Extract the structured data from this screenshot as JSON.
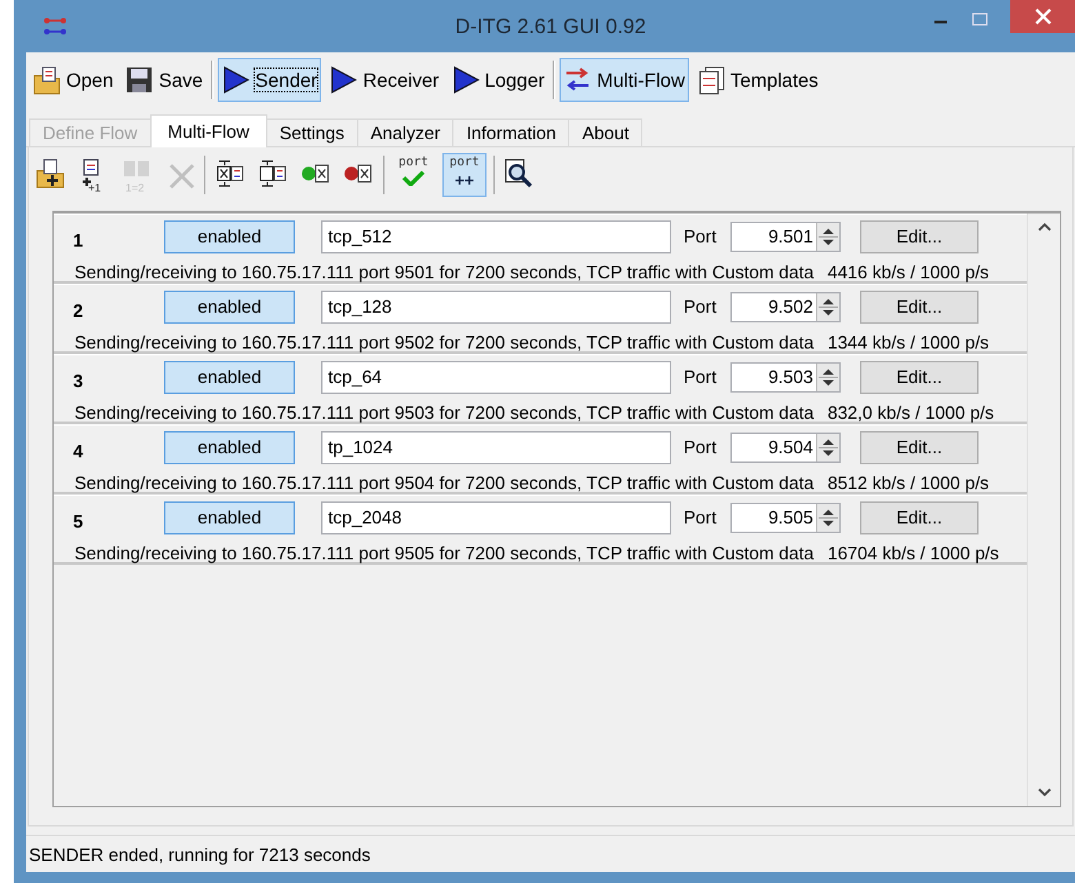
{
  "window": {
    "title": "D-ITG 2.61 GUI 0.92"
  },
  "toolbar": [
    {
      "kind": "open",
      "label": "Open",
      "selected": false
    },
    {
      "kind": "save",
      "label": "Save",
      "selected": false
    },
    {
      "kind": "play",
      "label": "Sender",
      "selected": true
    },
    {
      "kind": "play",
      "label": "Receiver",
      "selected": false
    },
    {
      "kind": "play",
      "label": "Logger",
      "selected": false
    },
    {
      "kind": "multiflow",
      "label": "Multi-Flow",
      "selected": true
    },
    {
      "kind": "templates",
      "label": "Templates",
      "selected": false
    }
  ],
  "tabs": [
    {
      "label": "Define Flow",
      "selected": false,
      "disabled": true
    },
    {
      "label": "Multi-Flow",
      "selected": true,
      "disabled": false
    },
    {
      "label": "Settings",
      "selected": false,
      "disabled": false
    },
    {
      "label": "Analyzer",
      "selected": false,
      "disabled": false
    },
    {
      "label": "Information",
      "selected": false,
      "disabled": false
    },
    {
      "label": "About",
      "selected": false,
      "disabled": false
    }
  ],
  "tools": [
    {
      "kind": "add-folder",
      "disabled": false,
      "selected": false
    },
    {
      "kind": "add-one",
      "text": "+1",
      "disabled": false,
      "selected": false
    },
    {
      "kind": "duplicate",
      "text": "1=2",
      "disabled": true,
      "selected": false
    },
    {
      "kind": "delete",
      "disabled": true,
      "selected": false
    },
    {
      "kind": "sep"
    },
    {
      "kind": "move-up",
      "disabled": false,
      "selected": false
    },
    {
      "kind": "move-down",
      "disabled": false,
      "selected": false
    },
    {
      "kind": "enable",
      "disabled": false,
      "selected": false
    },
    {
      "kind": "disable",
      "disabled": false,
      "selected": false
    },
    {
      "kind": "sep"
    },
    {
      "kind": "port-check",
      "text": "port",
      "disabled": false
    },
    {
      "kind": "port-add",
      "text": "port",
      "sub": "++",
      "disabled": false,
      "pressed": true
    },
    {
      "kind": "sep"
    },
    {
      "kind": "inspect",
      "disabled": false,
      "selected": false
    }
  ],
  "flows": [
    {
      "number": "1",
      "state": "enabled",
      "enabled": true,
      "name": "tcp_512",
      "port_label": "Port",
      "port": "9.501",
      "edit": "Edit...",
      "description": "Sending/receiving to 160.75.17.111 port 9501 for 7200 seconds, TCP traffic with Custom data",
      "rate": "4416 kb/s / 1000 p/s"
    },
    {
      "number": "2",
      "state": "enabled",
      "enabled": true,
      "name": "tcp_128",
      "port_label": "Port",
      "port": "9.502",
      "edit": "Edit...",
      "description": "Sending/receiving to 160.75.17.111 port 9502 for 7200 seconds, TCP traffic with Custom data",
      "rate": "1344 kb/s / 1000 p/s"
    },
    {
      "number": "3",
      "state": "enabled",
      "enabled": true,
      "name": "tcp_64",
      "port_label": "Port",
      "port": "9.503",
      "edit": "Edit...",
      "description": "Sending/receiving to 160.75.17.111 port 9503 for 7200 seconds, TCP traffic with Custom data",
      "rate": "832,0 kb/s / 1000 p/s"
    },
    {
      "number": "4",
      "state": "enabled",
      "enabled": true,
      "name": "tp_1024",
      "port_label": "Port",
      "port": "9.504",
      "edit": "Edit...",
      "description": "Sending/receiving to 160.75.17.111 port 9504 for 7200 seconds, TCP traffic with Custom data",
      "rate": "8512 kb/s / 1000 p/s"
    },
    {
      "number": "5",
      "state": "enabled",
      "enabled": true,
      "name": "tcp_2048",
      "port_label": "Port",
      "port": "9.505",
      "edit": "Edit...",
      "description": "Sending/receiving to 160.75.17.111 port 9505 for 7200 seconds, TCP traffic with Custom data",
      "rate": "16704 kb/s / 1000 p/s"
    }
  ],
  "status_bar": "SENDER ended, running for 7213 seconds"
}
